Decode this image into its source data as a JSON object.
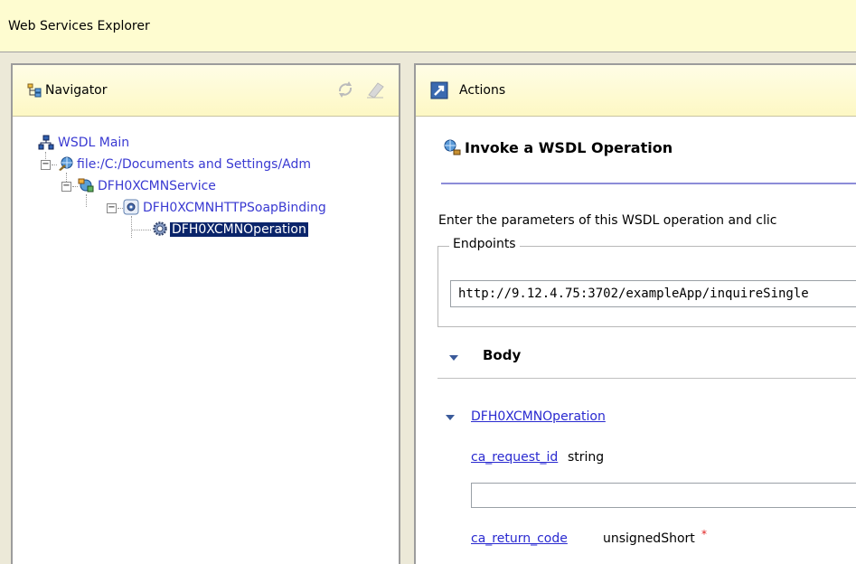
{
  "app": {
    "title": "Web Services Explorer"
  },
  "navigator": {
    "title": "Navigator",
    "icons": {
      "header": "navigator-icon",
      "refresh": "refresh-icon",
      "clear": "eraser-icon"
    },
    "tree": {
      "root": "WSDL Main",
      "file": "file:/C:/Documents and Settings/Adm",
      "service": "DFH0XCMNService",
      "binding": "DFH0XCMNHTTPSoapBinding",
      "operation": "DFH0XCMNOperation"
    }
  },
  "actions": {
    "title": "Actions",
    "section_title": "Invoke a WSDL Operation",
    "instruction": "Enter the parameters of this WSDL operation and clic",
    "endpoints_label": "Endpoints",
    "endpoint_value": "http://9.12.4.75:3702/exampleApp/inquireSingle",
    "body_label": "Body",
    "operation_link": "DFH0XCMNOperation",
    "fields": [
      {
        "name": "ca_request_id",
        "type": "string",
        "value": ""
      },
      {
        "name": "ca_return_code",
        "type": "unsignedShort",
        "required_marker": "*"
      }
    ]
  },
  "colors": {
    "header_bg": "#fefcd0",
    "link": "#2a2ad0",
    "selection": "#0a246a",
    "divider": "#8c8cd8",
    "required": "#e02020"
  }
}
